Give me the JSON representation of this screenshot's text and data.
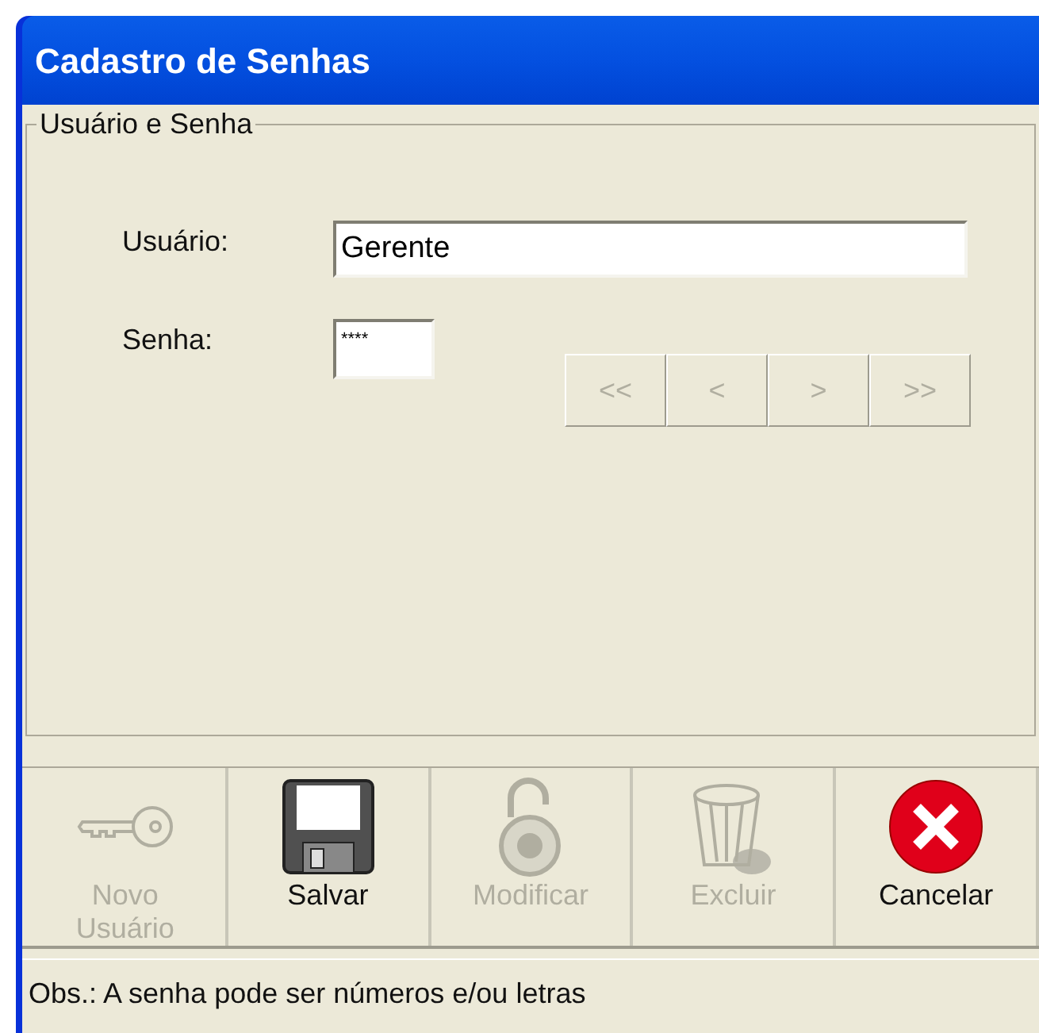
{
  "window": {
    "title": "Cadastro de Senhas"
  },
  "group": {
    "title": "Usuário e Senha",
    "fields": [
      {
        "label": "Usuário:",
        "value": "Gerente",
        "kind": "text"
      },
      {
        "label": "Senha:",
        "value": "****",
        "kind": "password"
      }
    ],
    "nav_buttons": [
      {
        "label": "<<",
        "disabled": true
      },
      {
        "label": "<",
        "disabled": true
      },
      {
        "label": ">",
        "disabled": true
      },
      {
        "label": ">>",
        "disabled": true
      }
    ]
  },
  "toolbar": [
    {
      "label": "Novo Usuário",
      "kind": "key",
      "disabled": true
    },
    {
      "label": "Salvar",
      "kind": "save",
      "disabled": false
    },
    {
      "label": "Modificar",
      "kind": "lock",
      "disabled": true
    },
    {
      "label": "Excluir",
      "kind": "trash",
      "disabled": true
    },
    {
      "label": "Cancelar",
      "kind": "cancel",
      "disabled": false
    }
  ],
  "status_bar": {
    "text": "Obs.: A senha pode ser números e/ou letras"
  }
}
